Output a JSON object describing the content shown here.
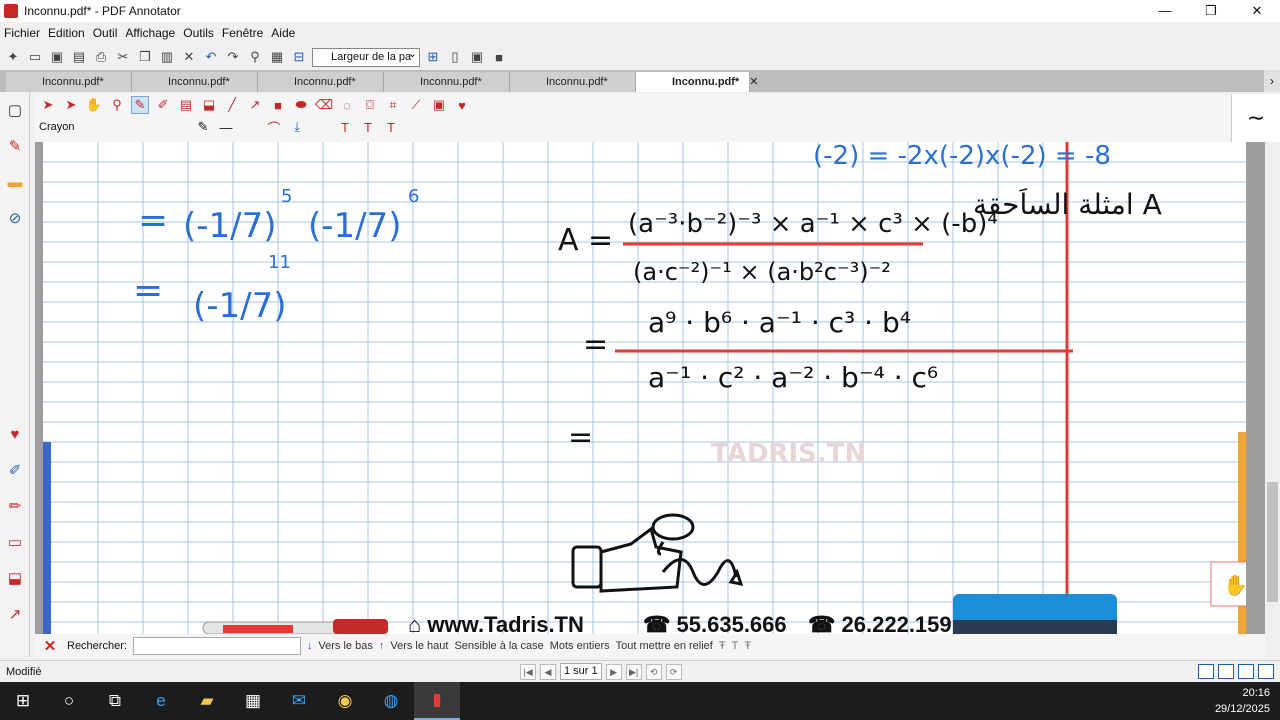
{
  "window": {
    "title": "Inconnu.pdf* - PDF Annotator",
    "minimize": "—",
    "restore": "❐",
    "close": "✕"
  },
  "menu": [
    "Fichier",
    "Edition",
    "Outil",
    "Affichage",
    "Outils",
    "Fenêtre",
    "Aide"
  ],
  "toolbar": {
    "zoom_value": "Largeur de la pa"
  },
  "tabs": [
    {
      "label": "Inconnu.pdf*"
    },
    {
      "label": "Inconnu.pdf*"
    },
    {
      "label": "Inconnu.pdf*"
    },
    {
      "label": "Inconnu.pdf*"
    },
    {
      "label": "Inconnu.pdf*"
    },
    {
      "label": "Inconnu.pdf*",
      "close": "✕"
    }
  ],
  "tool_label": "Crayon",
  "annotations": {
    "left_col": [
      "=",
      "=",
      "(-1/7)",
      "5",
      "6",
      "11"
    ],
    "top_right": "(-2) = -2x(-2)x(-2) = -8",
    "arabic": "امثلة الساَحقة A",
    "main_eq_A": "A =",
    "numerator": "(a⁻³·b⁻²)⁻³ × a⁻¹ × c³ × (-b)⁴",
    "denominator": "(a·c⁻²)⁻¹ × (a·b²c⁻³)⁻²",
    "eq2_num": "a⁹ · b⁶ · a⁻¹ · c³ · b⁴",
    "eq2_den": "a⁻¹ · c² · a⁻² · b⁻⁴ · c⁶",
    "equals": "=",
    "equals3": "=",
    "watermark": "TADRIS.TN"
  },
  "footer_banner": {
    "site": "www.Tadris.TN",
    "phone1": "55.635.666",
    "phone2": "26.222.159"
  },
  "findbar": {
    "label": "Rechercher:",
    "down": "Vers le bas",
    "up": "Vers le haut",
    "case": "Sensible à la case",
    "whole": "Mots entiers",
    "relief": "Tout mettre en relief"
  },
  "status": {
    "text": "Modifié",
    "page": "1 sur 1"
  },
  "clock": {
    "time": "20:16",
    "date": "29/12/2025"
  },
  "colors": {
    "accent": "#c62828",
    "ink_blue": "#2a6fd6",
    "grid": "#a9c4e8",
    "margin_red": "#e53935"
  }
}
